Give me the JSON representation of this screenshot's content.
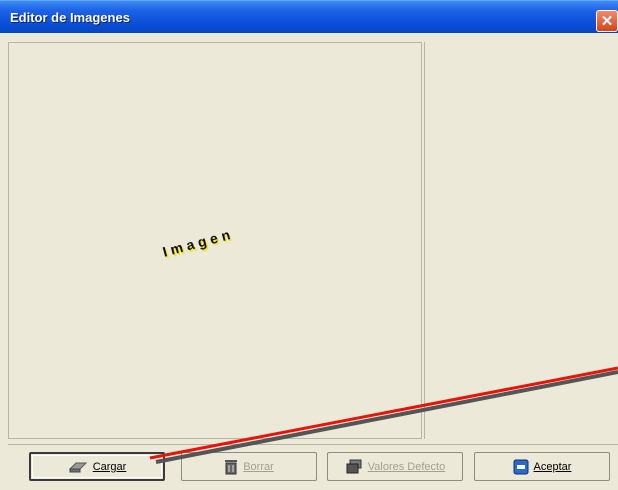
{
  "window": {
    "title": "Editor de Imagenes"
  },
  "preview": {
    "text": "Imagen"
  },
  "buttons": {
    "cargar": "Cargar",
    "borrar": "Borrar",
    "valores": "Valores Defecto",
    "aceptar": "Aceptar"
  },
  "colors": {
    "annotation": "#e8140c",
    "titlebar": "#0a4fd8",
    "preview_text_shadow": "#f5e600"
  }
}
